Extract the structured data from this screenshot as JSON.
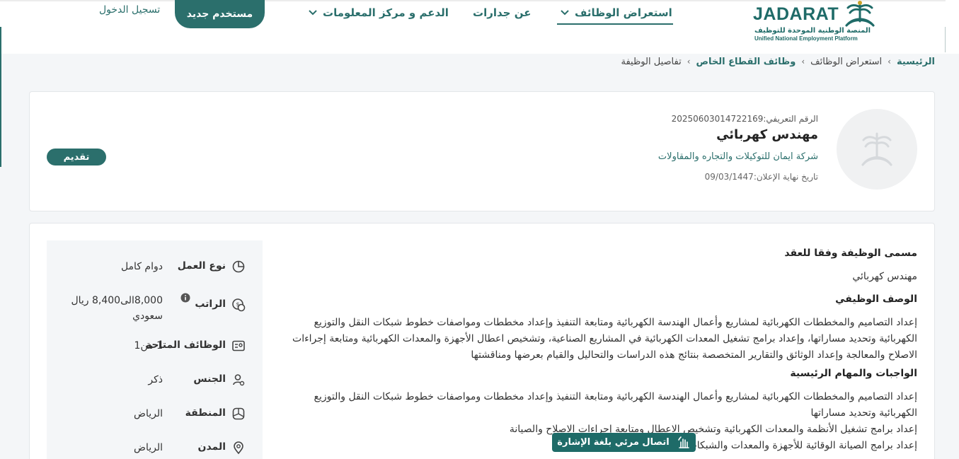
{
  "brand": {
    "logo_word": "JADARAT",
    "logo_ar": "المنصة الوطنية الموحدة للتوظيف",
    "logo_en": "Unified National Employment Platform"
  },
  "nav": {
    "browse_jobs": "استعراض الوظائف",
    "about": "عن جدارات",
    "support": "الدعم و مركز المعلومات",
    "new_user": "مستخدم جديد",
    "login": "تسجيل الدخول"
  },
  "breadcrumb": {
    "home": "الرئيسية",
    "browse": "استعراض الوظائف",
    "private_sector": "وظائف القطاع الخاص",
    "current": "تفاصيل الوظيفة"
  },
  "job": {
    "id_text": "الرقم التعريفي:20250603014722169",
    "title": "مهندس كهربائي",
    "company": "شركة ايمان للتوكيلات والتجاره والمقاولات",
    "deadline": "تاريخ نهاية الإعلان:09/03/1447",
    "apply_label": "تقديم"
  },
  "details": {
    "contract_title_heading": "مسمى الوظيفة وفقا للعقد",
    "contract_title_value": "مهندس كهربائي",
    "description_heading": "الوصف الوظيفي",
    "description_text": "إعداد التصاميم والمخططات الكهربائية لمشاريع وأعمال الهندسة الكهربائية ومتابعة التنفيذ وإعداد مخططات ومواصفات خطوط شبكات النقل والتوزيع الكهربائية وتحديد مساراتها، وإعداد برامج تشغيل المعدات الكهربائية في المشاريع الصناعية، وتشخيص اعطال الأجهزة والمعدات الكهربائية ومتابعة إجراءات الاصلاح والمعالجة وإعداد الوثائق والتقارير المتخصصة بنتائج هذه الدراسات والتحاليل والقيام بعرضها ومناقشتها",
    "duties_heading": "الواجبات والمهام الرئيسية",
    "duties": [
      "إعداد التصاميم والمخططات الكهربائية لمشاريع وأعمال الهندسة الكهربائية ومتابعة التنفيذ وإعداد مخططات ومواصفات خطوط شبكات النقل والتوزيع الكهربائية وتحديد مساراتها",
      "إعداد برامج تشغيل الأنظمة والمعدات الكهربائية وتشخيص الاعطال ومتابعة إجراءات الاصلاح والصيانة",
      "إعداد برامج الصيانة الوقائية للأجهزة والمعدات والشبكات بالشركة الصناعة والتعليمات"
    ]
  },
  "facts": [
    {
      "icon": "pie-chart-icon",
      "label": "نوع العمل",
      "value": "دوام كامل"
    },
    {
      "icon": "money-icon",
      "label": "الراتب",
      "value": "8,000الى8,400 ريال سعودي",
      "info_icon": "info-icon"
    },
    {
      "icon": "id-card-icon",
      "label": "الوظائف المتاحة",
      "value": "1 من1"
    },
    {
      "icon": "gender-icon",
      "label": "الجنس",
      "value": "ذكر"
    },
    {
      "icon": "region-icon",
      "label": "المنطقة",
      "value": "الرياض"
    },
    {
      "icon": "location-pin-icon",
      "label": "المدن",
      "value": "الرياض"
    }
  ],
  "sign_language": {
    "label": "اتصال مرئي بلغة الإشارة",
    "icon": "sign-language-icon"
  },
  "colors": {
    "brand": "#2b6f6c",
    "brand_dark": "#1e6b68",
    "panel": "#f4f6f8"
  }
}
